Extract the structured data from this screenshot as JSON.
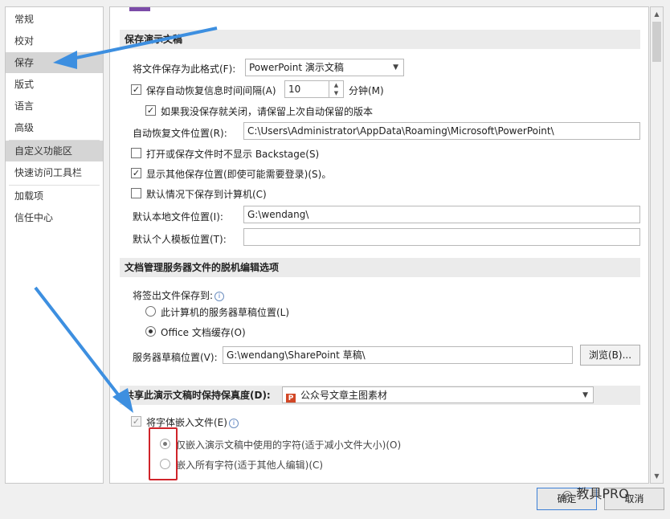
{
  "nav": {
    "items": [
      {
        "label": "常规"
      },
      {
        "label": "校对"
      },
      {
        "label": "保存"
      },
      {
        "label": "版式"
      },
      {
        "label": "语言"
      },
      {
        "label": "高级"
      },
      {
        "label": "自定义功能区"
      },
      {
        "label": "快速访问工具栏"
      },
      {
        "label": "加载项"
      },
      {
        "label": "信任中心"
      }
    ],
    "selected": "保存"
  },
  "save_section": {
    "header": "保存演示文稿",
    "format_label": "将文件保存为此格式(F):",
    "format_value": "PowerPoint 演示文稿",
    "autorecover_label": "保存自动恢复信息时间间隔(A)",
    "autorecover_checked": true,
    "autorecover_minutes": "10",
    "minutes_label": "分钟(M)",
    "keep_last_label": "如果我没保存就关闭，请保留上次自动保留的版本",
    "keep_last_checked": true,
    "autorecover_path_label": "自动恢复文件位置(R):",
    "autorecover_path": "C:\\Users\\Administrator\\AppData\\Roaming\\Microsoft\\PowerPoint\\",
    "no_backstage_label": "打开或保存文件时不显示 Backstage(S)",
    "no_backstage_checked": false,
    "show_more_label": "显示其他保存位置(即使可能需要登录)(S)。",
    "show_more_checked": true,
    "default_local_label": "默认情况下保存到计算机(C)",
    "default_local_checked": false,
    "local_path_label": "默认本地文件位置(I):",
    "local_path": "G:\\wendang\\",
    "template_path_label": "默认个人模板位置(T):",
    "template_path": ""
  },
  "offline_section": {
    "header": "文档管理服务器文件的脱机编辑选项",
    "checkout_label": "将签出文件保存到:",
    "option_server_label": "此计算机的服务器草稿位置(L)",
    "option_cache_label": "Office 文档缓存(O)",
    "selected_option": "Office 文档缓存(O)",
    "drafts_label": "服务器草稿位置(V):",
    "drafts_path": "G:\\wendang\\SharePoint 草稿\\",
    "browse_label": "浏览(B)..."
  },
  "fidelity_section": {
    "header": "共享此演示文稿时保持保真度(D):",
    "document_value": "公众号文章主图素材",
    "embed_fonts_label": "将字体嵌入文件(E)",
    "embed_fonts_checked": true,
    "embed_used_label": "仅嵌入演示文稿中使用的字符(适于减小文件大小)(O)",
    "embed_all_label": "嵌入所有字符(适于其他人编辑)(C)",
    "selected_embed": "仅嵌入演示文稿中使用的字符(适于减小文件大小)(O)"
  },
  "footer": {
    "ok_label": "确定",
    "cancel_label": "取消"
  },
  "watermark": {
    "text": "教具PRO"
  },
  "colors": {
    "annotation_arrow": "#3d8fe0",
    "highlight_box": "#d0242a",
    "selected_nav": "#d5d5d5",
    "section_header_bg": "#ebebeb"
  }
}
